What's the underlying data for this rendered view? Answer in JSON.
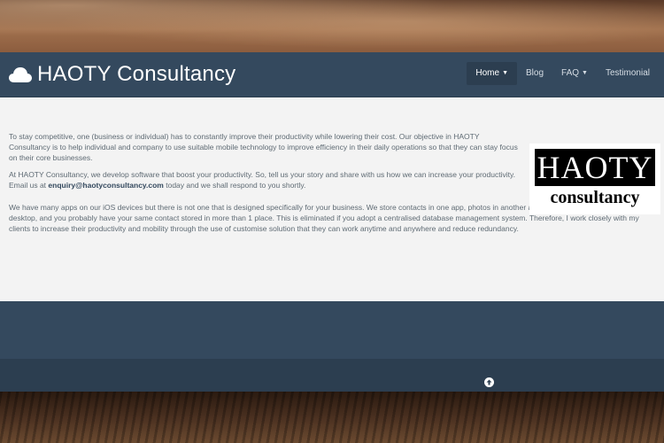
{
  "brand": {
    "name": "HAOTY Consultancy",
    "icon": "cloud-icon"
  },
  "nav": {
    "items": [
      {
        "label": "Home",
        "dropdown": true,
        "active": true
      },
      {
        "label": "Blog",
        "dropdown": false,
        "active": false
      },
      {
        "label": "FAQ",
        "dropdown": true,
        "active": false
      },
      {
        "label": "Testimonial",
        "dropdown": false,
        "active": false
      }
    ]
  },
  "content": {
    "p1": "To stay competitive, one (business or individual) has to constantly improve their productivity while lowering their cost. Our objective in HAOTY Consultancy is to help individual and company to use suitable mobile technology to improve efficiency in their daily operations so that they can stay focus on their core businesses.",
    "p2_before": "At HAOTY Consultancy, we develop software that boost your productivity. So, tell us your story and share with us how we can increase your productivity. Email us at ",
    "p2_email": "enquiry@haotyconsultancy.com",
    "p2_after": " today and we shall respond to you shortly.",
    "p3": "We have many apps on our iOS devices but there is not one that is designed specifically for your business. We store contacts in one app, photos in another app, quotation/invoices in your desktop, and you probably have your same contact stored in more than 1 place. This is eliminated if you adopt a centralised database management system. Therefore, I work closely with my clients to increase their productivity and mobility through the use of customise solution that they can work anytime and anywhere and reduce redundancy."
  },
  "logo": {
    "top": "HAOTY",
    "bottom": "consultancy"
  },
  "footer": {
    "scroll_icon": "arrow-up-circle-icon"
  },
  "colors": {
    "navbar": "#34495e",
    "footer_dark": "#2c3e50",
    "content_bg": "#f3f3f3"
  }
}
